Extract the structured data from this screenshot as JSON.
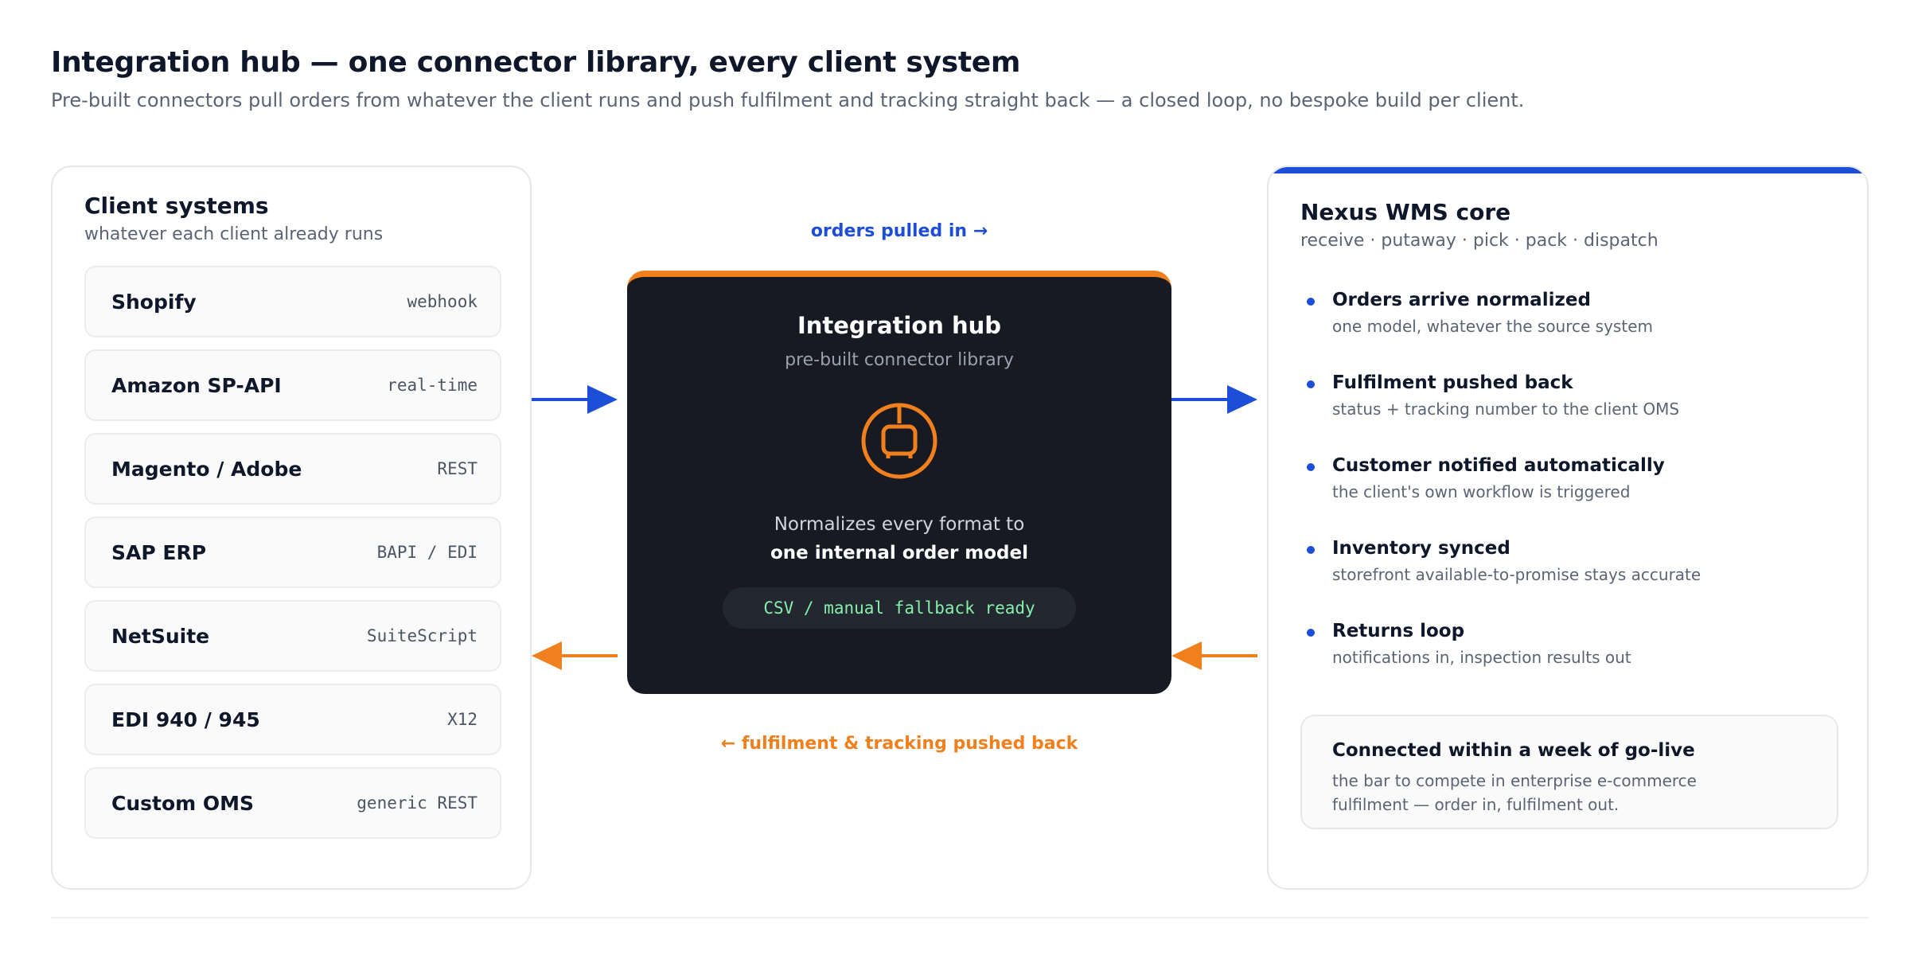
{
  "header": {
    "title": "Integration hub — one connector library, every client system",
    "subtitle": "Pre-built connectors pull orders from whatever the client runs and push fulfilment and tracking straight back — a closed loop, no bespoke build per client."
  },
  "client_systems": {
    "title": "Client systems",
    "subtitle": "whatever each client already runs",
    "items": [
      {
        "name": "Shopify",
        "protocol": "webhook"
      },
      {
        "name": "Amazon SP-API",
        "protocol": "real-time"
      },
      {
        "name": "Magento / Adobe",
        "protocol": "REST"
      },
      {
        "name": "SAP ERP",
        "protocol": "BAPI / EDI"
      },
      {
        "name": "NetSuite",
        "protocol": "SuiteScript"
      },
      {
        "name": "EDI 940 / 945",
        "protocol": "X12"
      },
      {
        "name": "Custom OMS",
        "protocol": "generic REST"
      }
    ]
  },
  "flows": {
    "inbound_label": "orders pulled in →",
    "outbound_label": "← fulfilment & tracking pushed back",
    "inbound_color": "#1d4ed8",
    "outbound_color": "#f0801e"
  },
  "hub": {
    "title": "Integration hub",
    "subtitle": "pre-built connector library",
    "icon": "connector-plug-icon",
    "desc_line1": "Normalizes every format to",
    "desc_line2": "one internal order model",
    "fallback_pill": "CSV / manual fallback ready"
  },
  "wms": {
    "title": "Nexus WMS core",
    "subtitle": "receive · putaway · pick · pack · dispatch",
    "features": [
      {
        "title": "Orders arrive normalized",
        "desc": "one model, whatever the source system"
      },
      {
        "title": "Fulfilment pushed back",
        "desc": "status + tracking number to the client OMS"
      },
      {
        "title": "Customer notified automatically",
        "desc": "the client's own workflow is triggered"
      },
      {
        "title": "Inventory synced",
        "desc": "storefront available-to-promise stays accurate"
      },
      {
        "title": "Returns loop",
        "desc": "notifications in, inspection results out"
      }
    ],
    "callout": {
      "title": "Connected within a week of go-live",
      "body": "the bar to compete in enterprise e-commerce fulfilment — order in, fulfilment out."
    }
  },
  "colors": {
    "accent_blue": "#1d4ed8",
    "accent_orange": "#f0801e",
    "hub_bg": "#171a22"
  }
}
